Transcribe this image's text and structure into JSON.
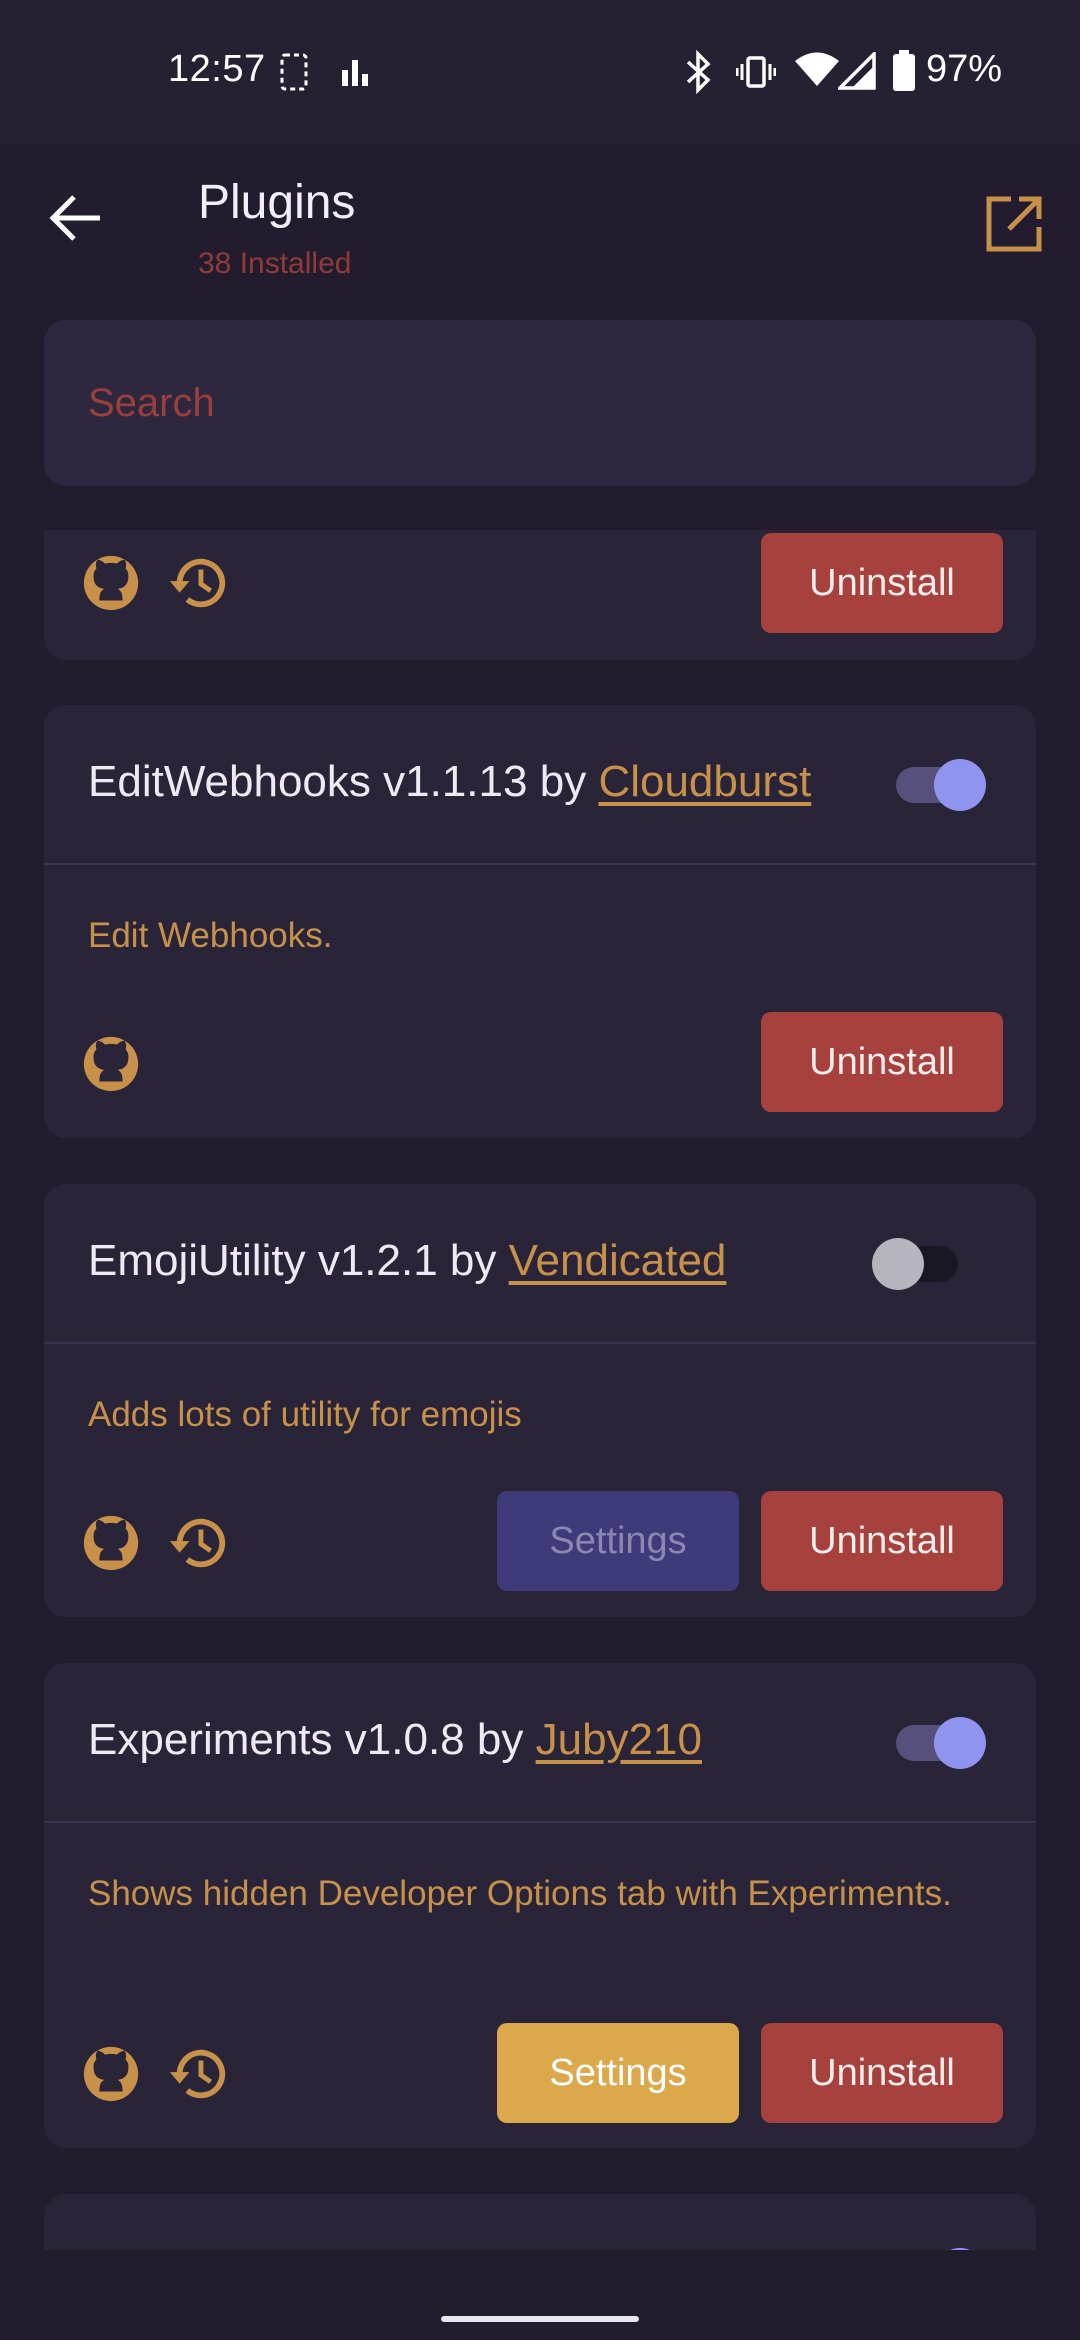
{
  "status_bar": {
    "time": "12:57",
    "battery": "97%"
  },
  "header": {
    "title": "Plugins",
    "subtitle": "38 Installed"
  },
  "search": {
    "placeholder": "Search",
    "value": ""
  },
  "plugins": [
    {
      "name": "",
      "version": "",
      "author": "",
      "description": "",
      "uninstall_label": "Uninstall"
    },
    {
      "name": "EditWebhooks",
      "version": "v1.1.13",
      "by": "by",
      "author": "Cloudburst",
      "enabled": true,
      "description": "Edit Webhooks.",
      "uninstall_label": "Uninstall"
    },
    {
      "name": "EmojiUtility",
      "version": "v1.2.1",
      "by": "by",
      "author": "Vendicated",
      "enabled": false,
      "description": "Adds lots of utility for emojis",
      "settings_label": "Settings",
      "uninstall_label": "Uninstall"
    },
    {
      "name": "Experiments",
      "version": "v1.0.8",
      "by": "by",
      "author": "Juby210",
      "enabled": true,
      "description": "Shows hidden Developer Options tab with Experiments.",
      "settings_label": "Settings",
      "uninstall_label": "Uninstall"
    }
  ],
  "colors": {
    "background": "#221c2e",
    "card": "#2a2439",
    "accent_gold": "#c8914a",
    "uninstall": "#a6413d",
    "settings_active": "#dba84c",
    "settings_disabled": "#3f3a7a",
    "toggle_on": "#8f95ee"
  }
}
